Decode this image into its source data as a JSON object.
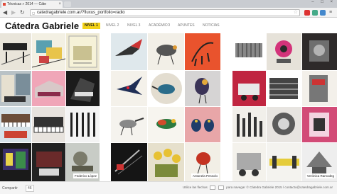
{
  "browser": {
    "tab_title": "Técnicas » 2014 — Cáte",
    "tab_close": "×",
    "window_controls": "– □ ×",
    "url": "catedragabriele.com.ar/?fluxus_portfolio=radio",
    "back": "◀",
    "forward": "▶",
    "reload": "↻"
  },
  "site": {
    "logo": "Cátedra Gabriele",
    "nav": [
      {
        "label": "NIVEL 1",
        "active": true
      },
      {
        "label": "NIVEL 2",
        "active": false
      },
      {
        "label": "NIVEL 3",
        "active": false
      },
      {
        "label": "ACADÉMICO",
        "active": false
      },
      {
        "label": "APUNTES",
        "active": false
      },
      {
        "label": "NOTICIAS",
        "active": false
      }
    ]
  },
  "gallery": {
    "captions": [
      "Federico López",
      "Antonela Pessolo",
      "Verónica Ramodeg"
    ]
  },
  "footer": {
    "share_label": "Compartir",
    "share_count": "46",
    "hint_before": "Utilice las flechas",
    "hint_after": "para navegar",
    "copyright": "© Cátedra Gabriele 2015 / contacto@catedragabriele.com.ar"
  },
  "colors": {
    "accent": "#f3d217",
    "chrome_tabs": "#c9ccd1",
    "chrome_toolbar": "#f2f2f2"
  }
}
